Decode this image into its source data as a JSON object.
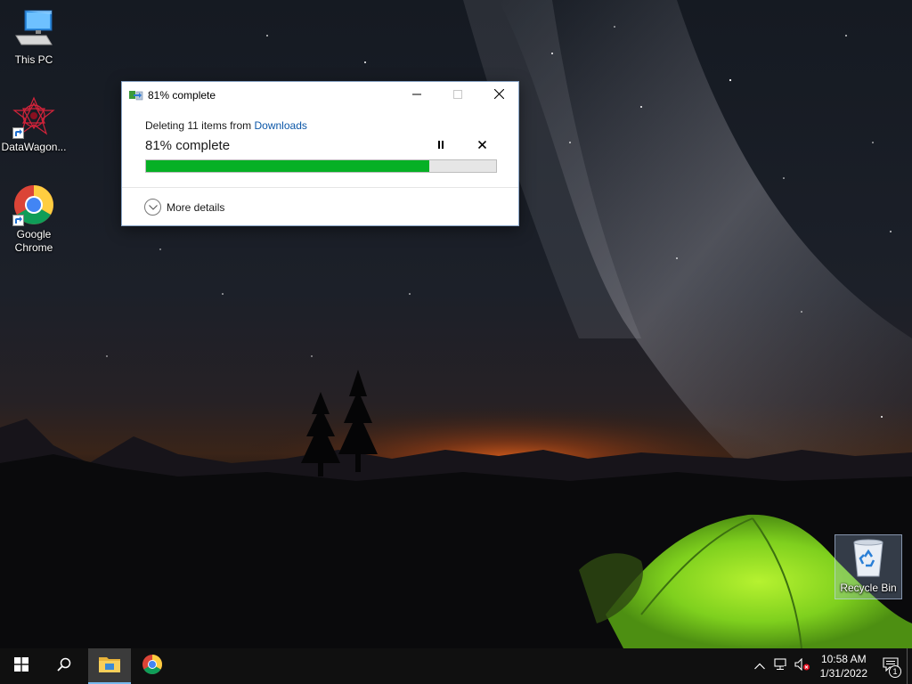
{
  "desktop": {
    "icons": [
      {
        "label": "This PC",
        "icon": "computer-icon"
      },
      {
        "label": "DataWagon...",
        "icon": "datawagon-app-icon"
      },
      {
        "label": "Google Chrome",
        "icon": "chrome-icon"
      },
      {
        "label": "Recycle Bin",
        "icon": "recycle-bin-icon"
      }
    ]
  },
  "dialog": {
    "title": "81% complete",
    "subtitle_prefix": "Deleting 11 items from ",
    "subtitle_link": "Downloads",
    "progress_text": "81% complete",
    "progress_value": 0.81,
    "more_details": "More details",
    "controls": [
      "minimize-icon",
      "maximize-icon",
      "close-icon"
    ],
    "actions": [
      "pause-icon",
      "cancel-icon"
    ]
  },
  "taskbar": {
    "items": [
      "start-icon",
      "search-icon",
      "file-explorer-icon",
      "chrome-icon"
    ],
    "tray": [
      "chevron-up-icon",
      "network-icon",
      "volume-muted-icon"
    ],
    "time": "10:58 AM",
    "date": "1/31/2022",
    "notification_count": "1"
  },
  "colors": {
    "progress_fill": "#06b025",
    "link": "#0c57a8",
    "taskbar": "#101010",
    "tent": "#8ee12a"
  }
}
